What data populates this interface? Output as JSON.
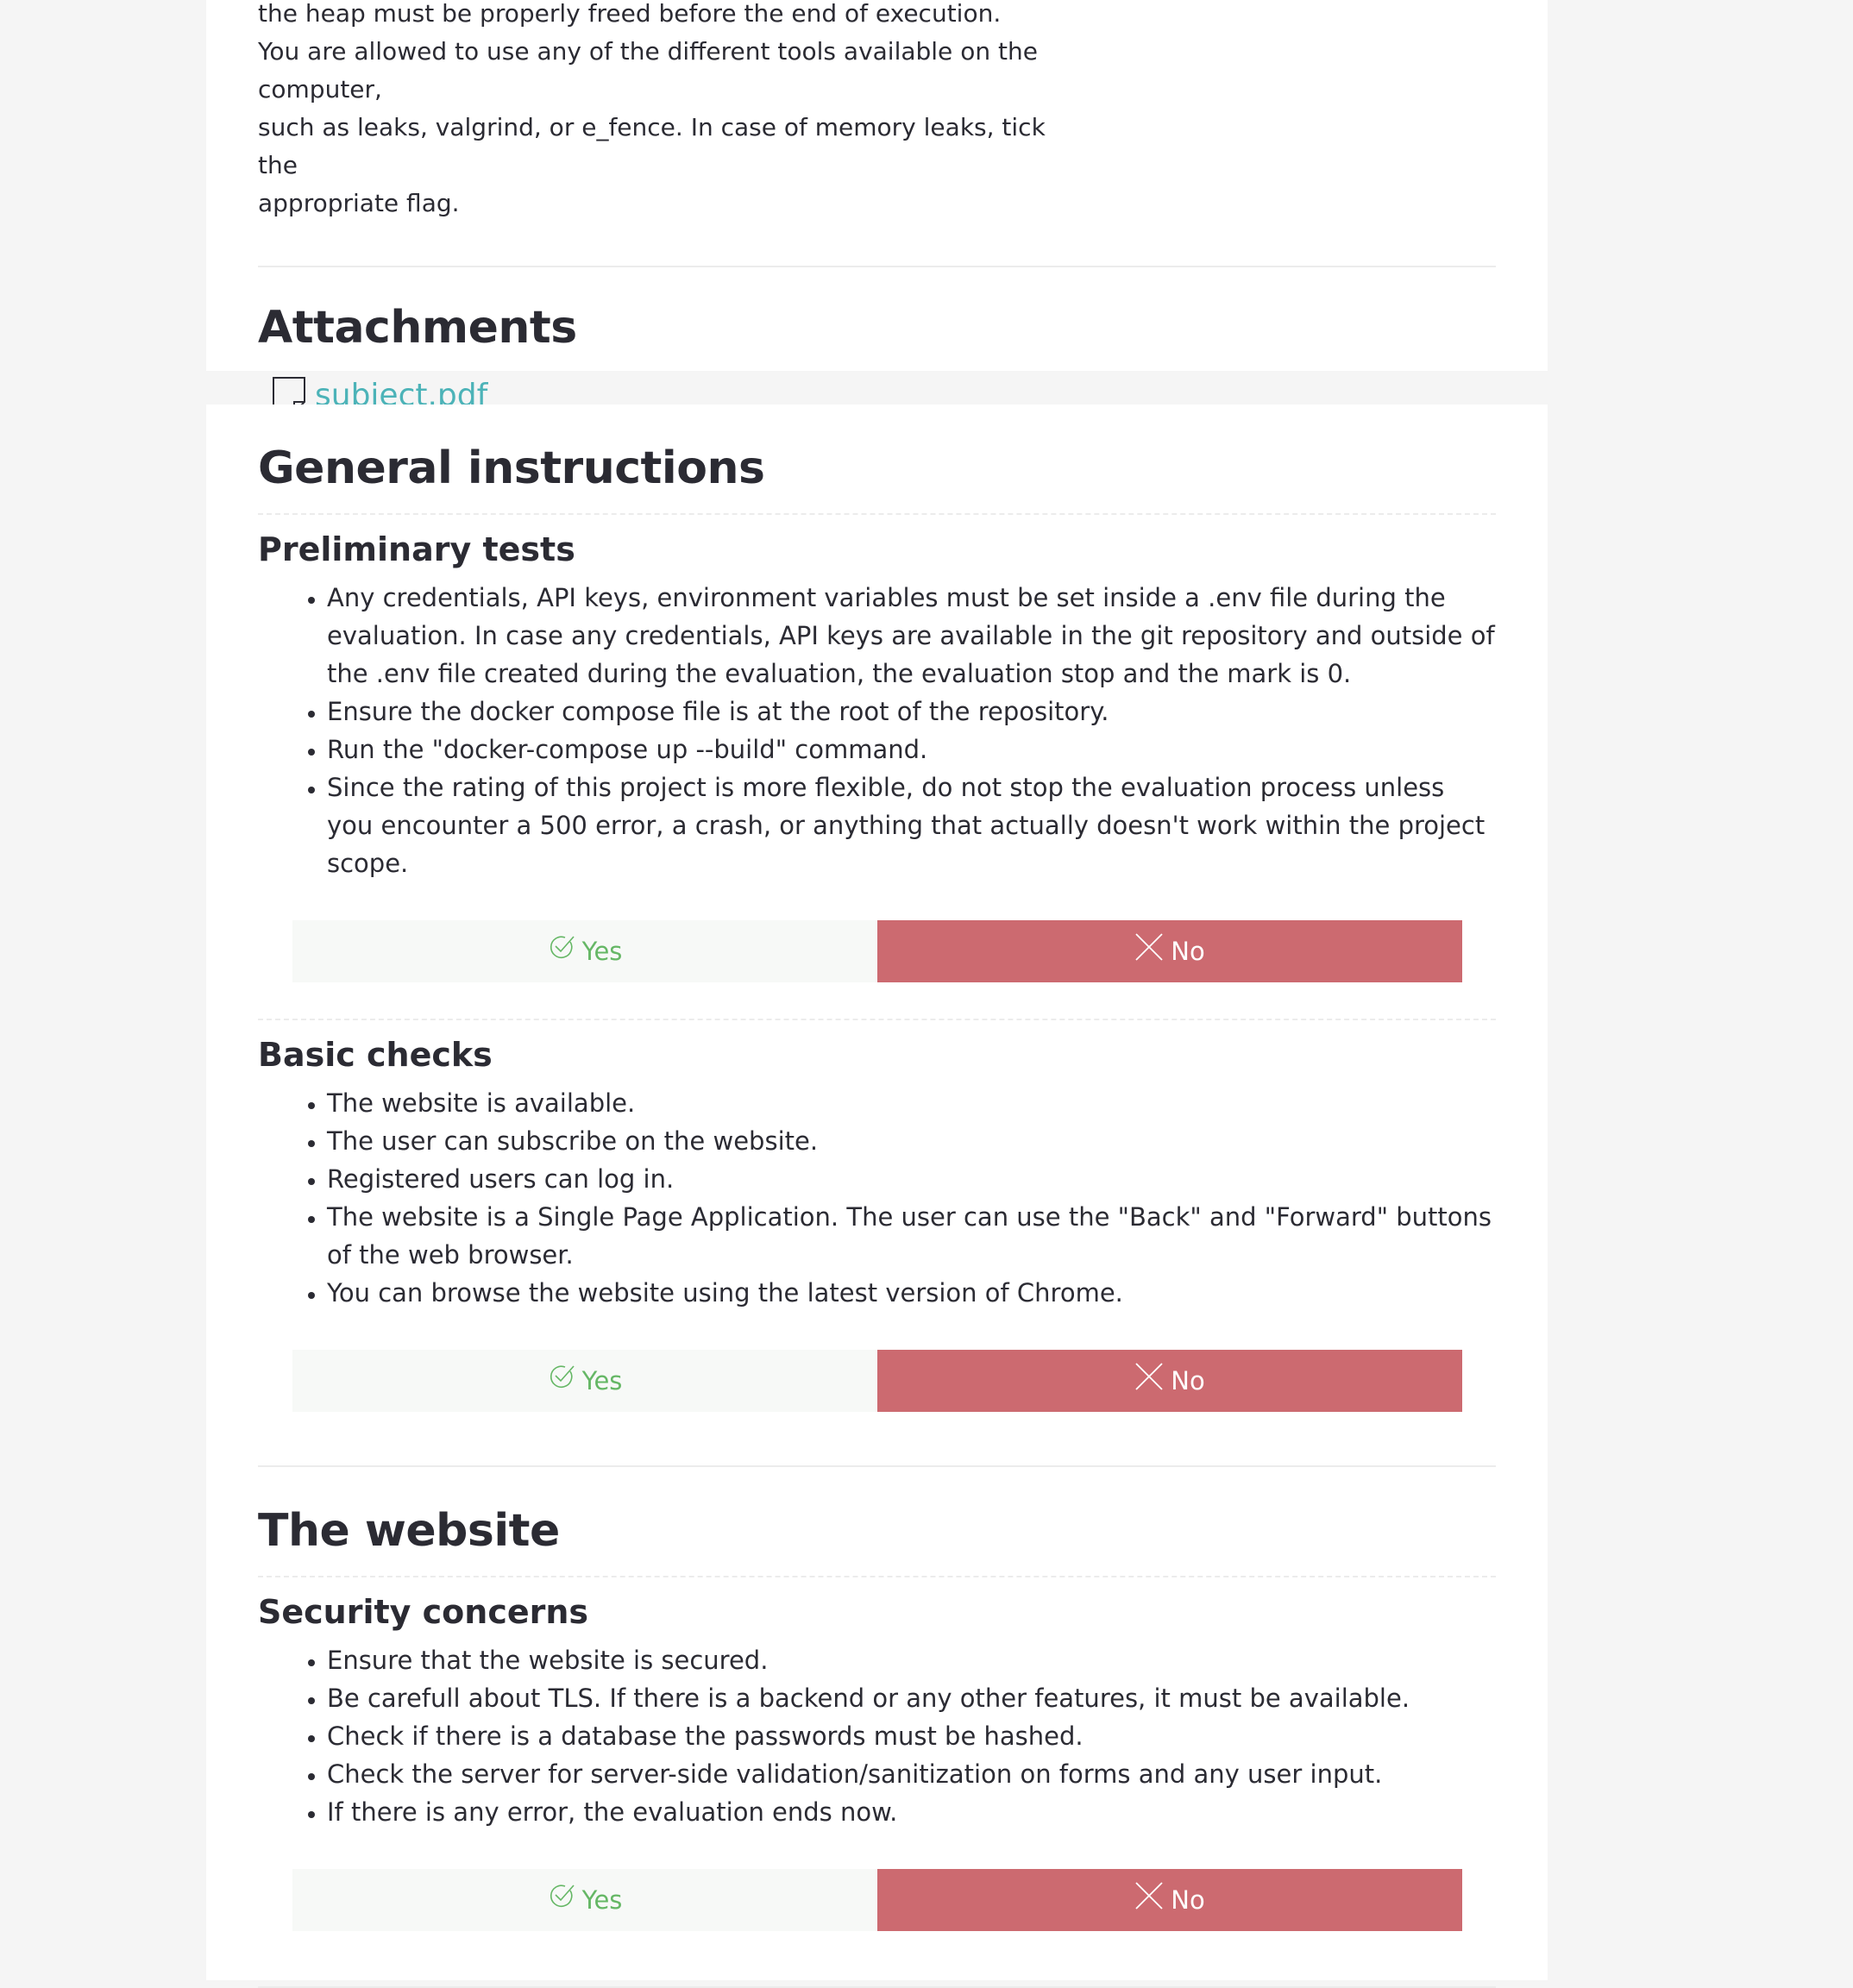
{
  "intro": {
    "lines": [
      "the heap must be properly freed before the end of execution.",
      "You are allowed to use any of the different tools available on the computer,",
      "such as leaks, valgrind, or e_fence. In case of memory leaks, tick the",
      "appropriate flag."
    ]
  },
  "attachments": {
    "heading": "Attachments",
    "file_label": "subject.pdf"
  },
  "general": {
    "heading": "General instructions",
    "preliminary": {
      "heading": "Preliminary tests",
      "items": [
        "Any credentials, API keys, environment variables must be set inside a .env file during the evaluation. In case any credentials, API keys are available in the git repository and outside of the .env file created during the evaluation, the evaluation stop and the mark is 0.",
        "Ensure the docker compose file is at the root of the repository.",
        "Run the \"docker-compose up --build\" command.",
        "Since the rating of this project is more flexible, do not stop the evaluation process unless you encounter a 500 error, a crash, or anything that actually doesn't work within the project scope."
      ]
    },
    "basic": {
      "heading": "Basic checks",
      "items": [
        "The website is available.",
        "The user can subscribe on the website.",
        "Registered users can log in.",
        "The website is a Single Page Application. The user can use the \"Back\" and \"Forward\" buttons of the web browser.",
        "You can browse the website using the latest version of Chrome."
      ]
    }
  },
  "website": {
    "heading": "The website",
    "security": {
      "heading": "Security concerns",
      "items": [
        "Ensure that the website is secured.",
        "Be carefull about TLS. If there is a backend or any other features, it must be available.",
        "Check if there is a database the passwords must be hashed.",
        "Check the server for server-side validation/sanitization on forms and any user input.",
        "If there is any error, the evaluation ends now."
      ]
    }
  },
  "vote": {
    "yes_label": "Yes",
    "no_label": "No",
    "yes_icon": "check-icon",
    "no_icon": "cross-icon"
  },
  "colors": {
    "link": "#4cb3b8",
    "yes_text": "#65b765",
    "no_background": "#cc6a70"
  }
}
